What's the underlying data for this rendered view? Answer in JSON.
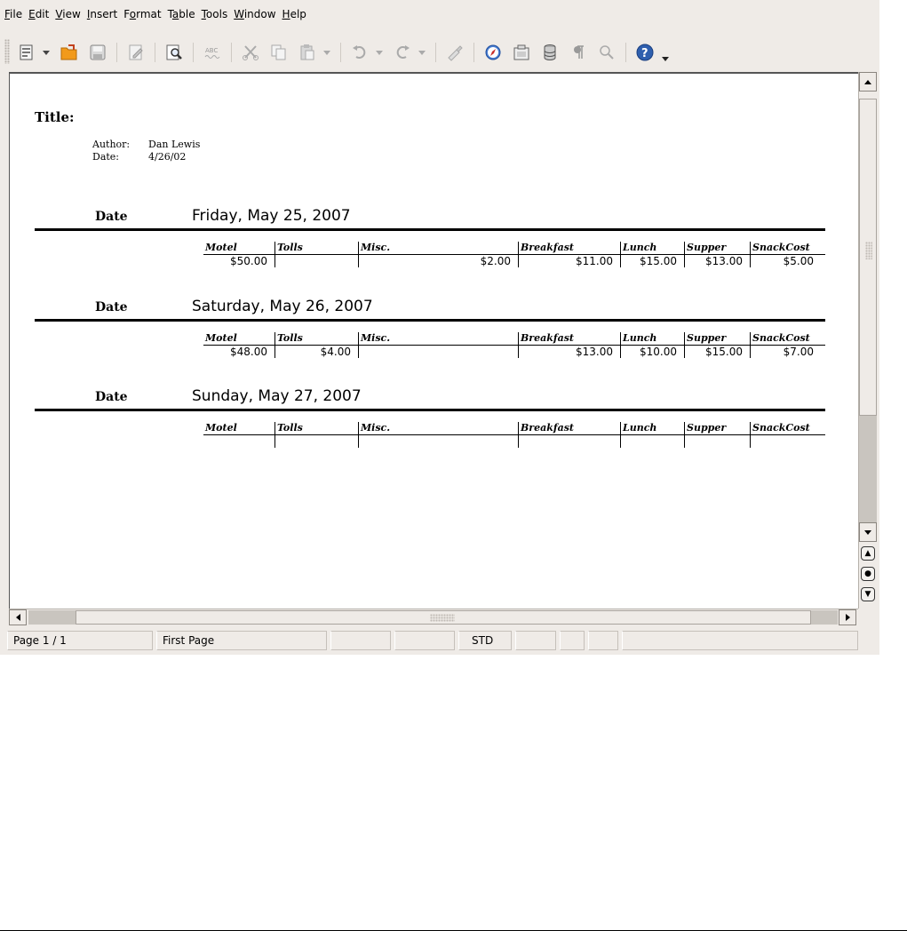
{
  "menubar": {
    "items": [
      {
        "accel": "F",
        "rest": "ile"
      },
      {
        "accel": "E",
        "rest": "dit"
      },
      {
        "accel": "V",
        "rest": "iew"
      },
      {
        "accel": "I",
        "rest": "nsert"
      },
      {
        "pre": "F",
        "accel": "o",
        "rest": "rmat"
      },
      {
        "pre": "T",
        "accel": "a",
        "rest": "ble"
      },
      {
        "accel": "T",
        "rest": "ools"
      },
      {
        "accel": "W",
        "rest": "indow"
      },
      {
        "accel": "H",
        "rest": "elp"
      }
    ]
  },
  "toolbar": {
    "icons": [
      "new-document-icon",
      "open-folder-icon",
      "save-icon",
      "edit-file-icon",
      "page-preview-icon",
      "spellcheck-icon",
      "cut-icon",
      "copy-icon",
      "paste-icon",
      "undo-icon",
      "redo-icon",
      "format-paintbrush-icon",
      "navigator-icon",
      "gallery-icon",
      "data-sources-icon",
      "formatting-marks-icon",
      "zoom-icon",
      "help-icon"
    ],
    "spellcheck_label": "ABC"
  },
  "document": {
    "title_label": "Title:",
    "author_key": "Author:",
    "author_value": "Dan Lewis",
    "date_key": "Date:",
    "date_value": "4/26/02",
    "columns": [
      "Motel",
      "Tolls",
      "Misc.",
      "Breakfast",
      "Lunch",
      "Supper",
      "SnackCost"
    ],
    "sections": [
      {
        "label": "Date",
        "value": "Friday, May 25, 2007",
        "row": [
          "$50.00",
          "",
          "$2.00",
          "$11.00",
          "$15.00",
          "$13.00",
          "$5.00"
        ]
      },
      {
        "label": "Date",
        "value": "Saturday, May 26, 2007",
        "row": [
          "$48.00",
          "$4.00",
          "",
          "$13.00",
          "$10.00",
          "$15.00",
          "$7.00"
        ]
      },
      {
        "label": "Date",
        "value": "Sunday, May 27, 2007",
        "row": [
          "",
          "",
          "",
          "",
          "",
          "",
          ""
        ]
      }
    ]
  },
  "statusbar": {
    "page": "Page 1 / 1",
    "page_style": "First Page",
    "zoom": "",
    "insert_mode": "",
    "selection_mode": "STD",
    "doc_modified": "",
    "signature": "",
    "extra": "",
    "info": ""
  },
  "colors": {
    "chrome": "#efebe7",
    "page": "#ffffff",
    "folder_orange": "#f29a1b",
    "help_blue": "#2f5fae"
  }
}
